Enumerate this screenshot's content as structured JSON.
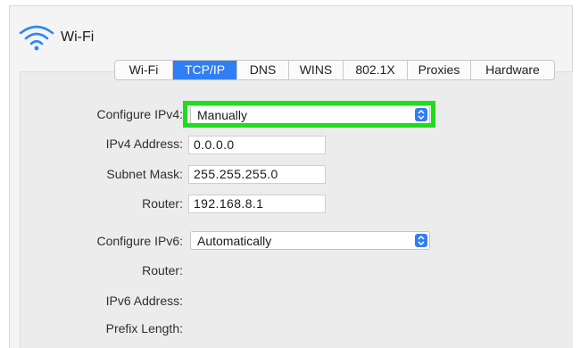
{
  "window": {
    "title": "Wi-Fi",
    "icon": "wifi-icon"
  },
  "tabs": [
    {
      "label": "Wi-Fi",
      "active": false
    },
    {
      "label": "TCP/IP",
      "active": true
    },
    {
      "label": "DNS",
      "active": false
    },
    {
      "label": "WINS",
      "active": false
    },
    {
      "label": "802.1X",
      "active": false
    },
    {
      "label": "Proxies",
      "active": false
    },
    {
      "label": "Hardware",
      "active": false
    }
  ],
  "ipv4": {
    "configure_label": "Configure IPv4:",
    "configure_value": "Manually",
    "address_label": "IPv4 Address:",
    "address_value": "0.0.0.0",
    "subnet_label": "Subnet Mask:",
    "subnet_value": "255.255.255.0",
    "router_label": "Router:",
    "router_value": "192.168.8.1"
  },
  "ipv6": {
    "configure_label": "Configure IPv6:",
    "configure_value": "Automatically",
    "router_label": "Router:",
    "address_label": "IPv6 Address:",
    "prefix_label": "Prefix Length:"
  },
  "colors": {
    "accent": "#2f7ef4",
    "highlight": "#1fdc1f",
    "panel": "#ececec"
  }
}
